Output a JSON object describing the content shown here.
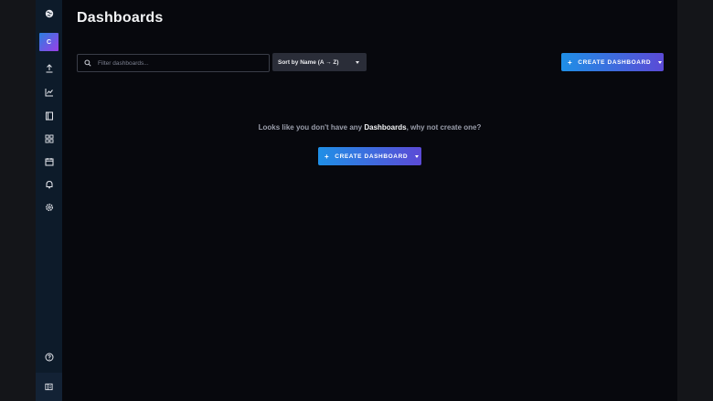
{
  "sidebar": {
    "org_initial": "C",
    "items": [
      {
        "icon": "globe-logo-icon"
      },
      {
        "icon": "upload-icon"
      },
      {
        "icon": "line-chart-icon"
      },
      {
        "icon": "book-icon"
      },
      {
        "icon": "dashboard-grid-icon"
      },
      {
        "icon": "calendar-icon"
      },
      {
        "icon": "bell-icon"
      },
      {
        "icon": "gear-icon"
      },
      {
        "icon": "help-icon"
      },
      {
        "icon": "collapse-sidebar-icon"
      }
    ]
  },
  "header": {
    "title": "Dashboards"
  },
  "toolbar": {
    "search_placeholder": "Filter dashboards...",
    "sort_label": "Sort by Name (A → Z)",
    "create_plus": "+",
    "create_label": "CREATE DASHBOARD"
  },
  "empty_state": {
    "before": "Looks like you don't have any ",
    "highlight": "Dashboards",
    "after": ", why not create one?",
    "create_plus": "+",
    "create_label": "CREATE DASHBOARD"
  },
  "colors": {
    "sidebar_bg": "#0d1b2a",
    "main_bg": "#07080d",
    "accent_start": "#1f8fe6",
    "accent_end": "#5b4ad6"
  }
}
